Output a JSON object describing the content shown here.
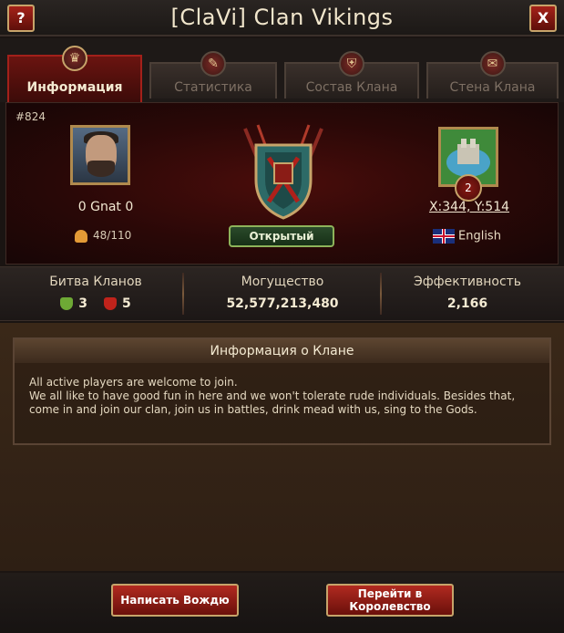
{
  "window": {
    "title": "[ClaVi] Clan Vikings",
    "help_label": "?",
    "close_label": "X"
  },
  "tabs": [
    {
      "label": "Информация",
      "active": true
    },
    {
      "label": "Статистика",
      "active": false
    },
    {
      "label": "Состав Клана",
      "active": false
    },
    {
      "label": "Стена Клана",
      "active": false
    }
  ],
  "clan": {
    "id": "#824",
    "leader_name": "0 Gnat 0",
    "members": "48/110",
    "status": "Открытый",
    "castle_level": "2",
    "coords": "X:344, Y:514",
    "language": "English"
  },
  "stats": {
    "battle_label": "Битва Кланов",
    "wins": "3",
    "losses": "5",
    "power_label": "Могущество",
    "power_value": "52,577,213,480",
    "efficiency_label": "Эффективность",
    "efficiency_value": "2,166"
  },
  "description": {
    "title": "Информация о Клане",
    "text": "All active players are welcome to join.\nWe all like to have good fun in here and we won't tolerate rude individuals. Besides that, come in and join our clan, join us in battles, drink mead with us, sing to the Gods."
  },
  "footer": {
    "message_leader": "Написать Вождю",
    "go_to_kingdom": "Перейти в Королевство"
  }
}
